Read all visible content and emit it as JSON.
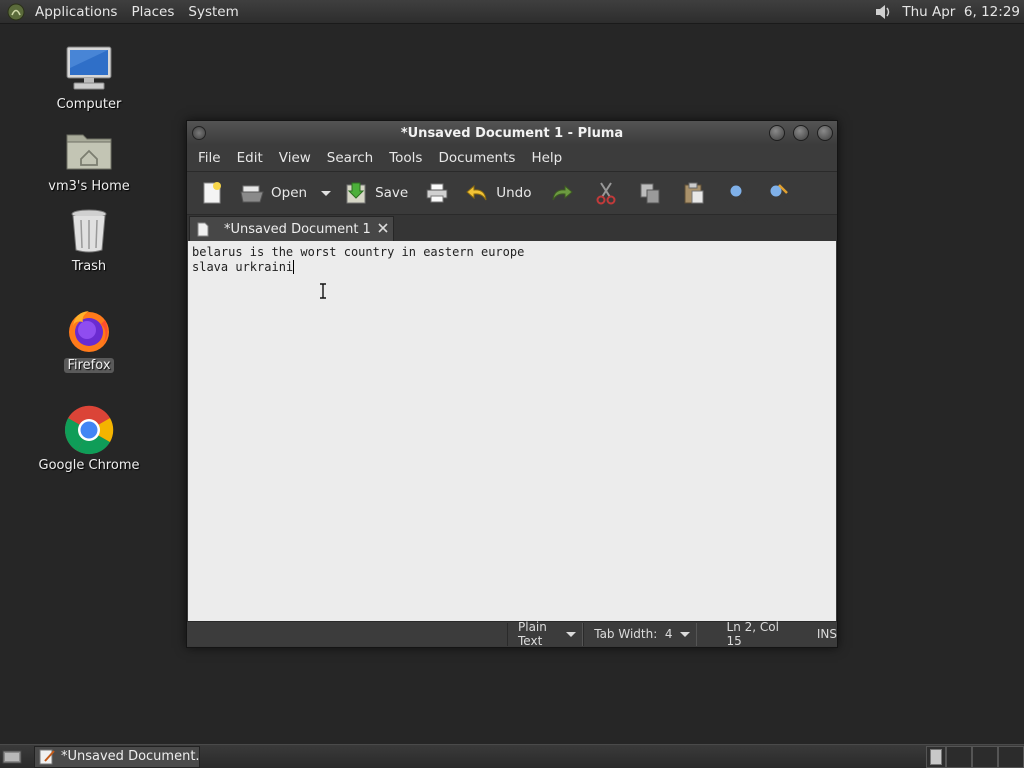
{
  "top_panel": {
    "menus": [
      "Applications",
      "Places",
      "System"
    ],
    "clock": "Thu Apr  6, 12:29",
    "icons": [
      "mate-menu-icon",
      "volume-icon"
    ]
  },
  "desktop": {
    "icons": [
      {
        "label": "Computer",
        "icon": "computer-icon"
      },
      {
        "label": "vm3's Home",
        "icon": "home-folder-icon"
      },
      {
        "label": "Trash",
        "icon": "trash-icon"
      },
      {
        "label": "Firefox",
        "icon": "firefox-icon"
      },
      {
        "label": "Google Chrome",
        "icon": "chrome-icon"
      }
    ]
  },
  "window": {
    "title": "*Unsaved Document 1 - Pluma",
    "menubar": [
      "File",
      "Edit",
      "View",
      "Search",
      "Tools",
      "Documents",
      "Help"
    ],
    "toolbar": {
      "open_label": "Open",
      "save_label": "Save",
      "undo_label": "Undo"
    },
    "tab": {
      "label": "*Unsaved Document 1"
    },
    "editor": {
      "lines": [
        "belarus is the worst country in eastern europe",
        "slava urkraini"
      ]
    },
    "status": {
      "language": "Plain Text",
      "tab_width": "Tab Width:  4",
      "position": "Ln 2, Col 15",
      "mode": "INS"
    }
  },
  "bottom_panel": {
    "task_label": "*Unsaved Document..."
  },
  "colors": {
    "desktop_bg": "#262626",
    "panel_bg": "#333333",
    "editor_bg": "#ececec"
  }
}
